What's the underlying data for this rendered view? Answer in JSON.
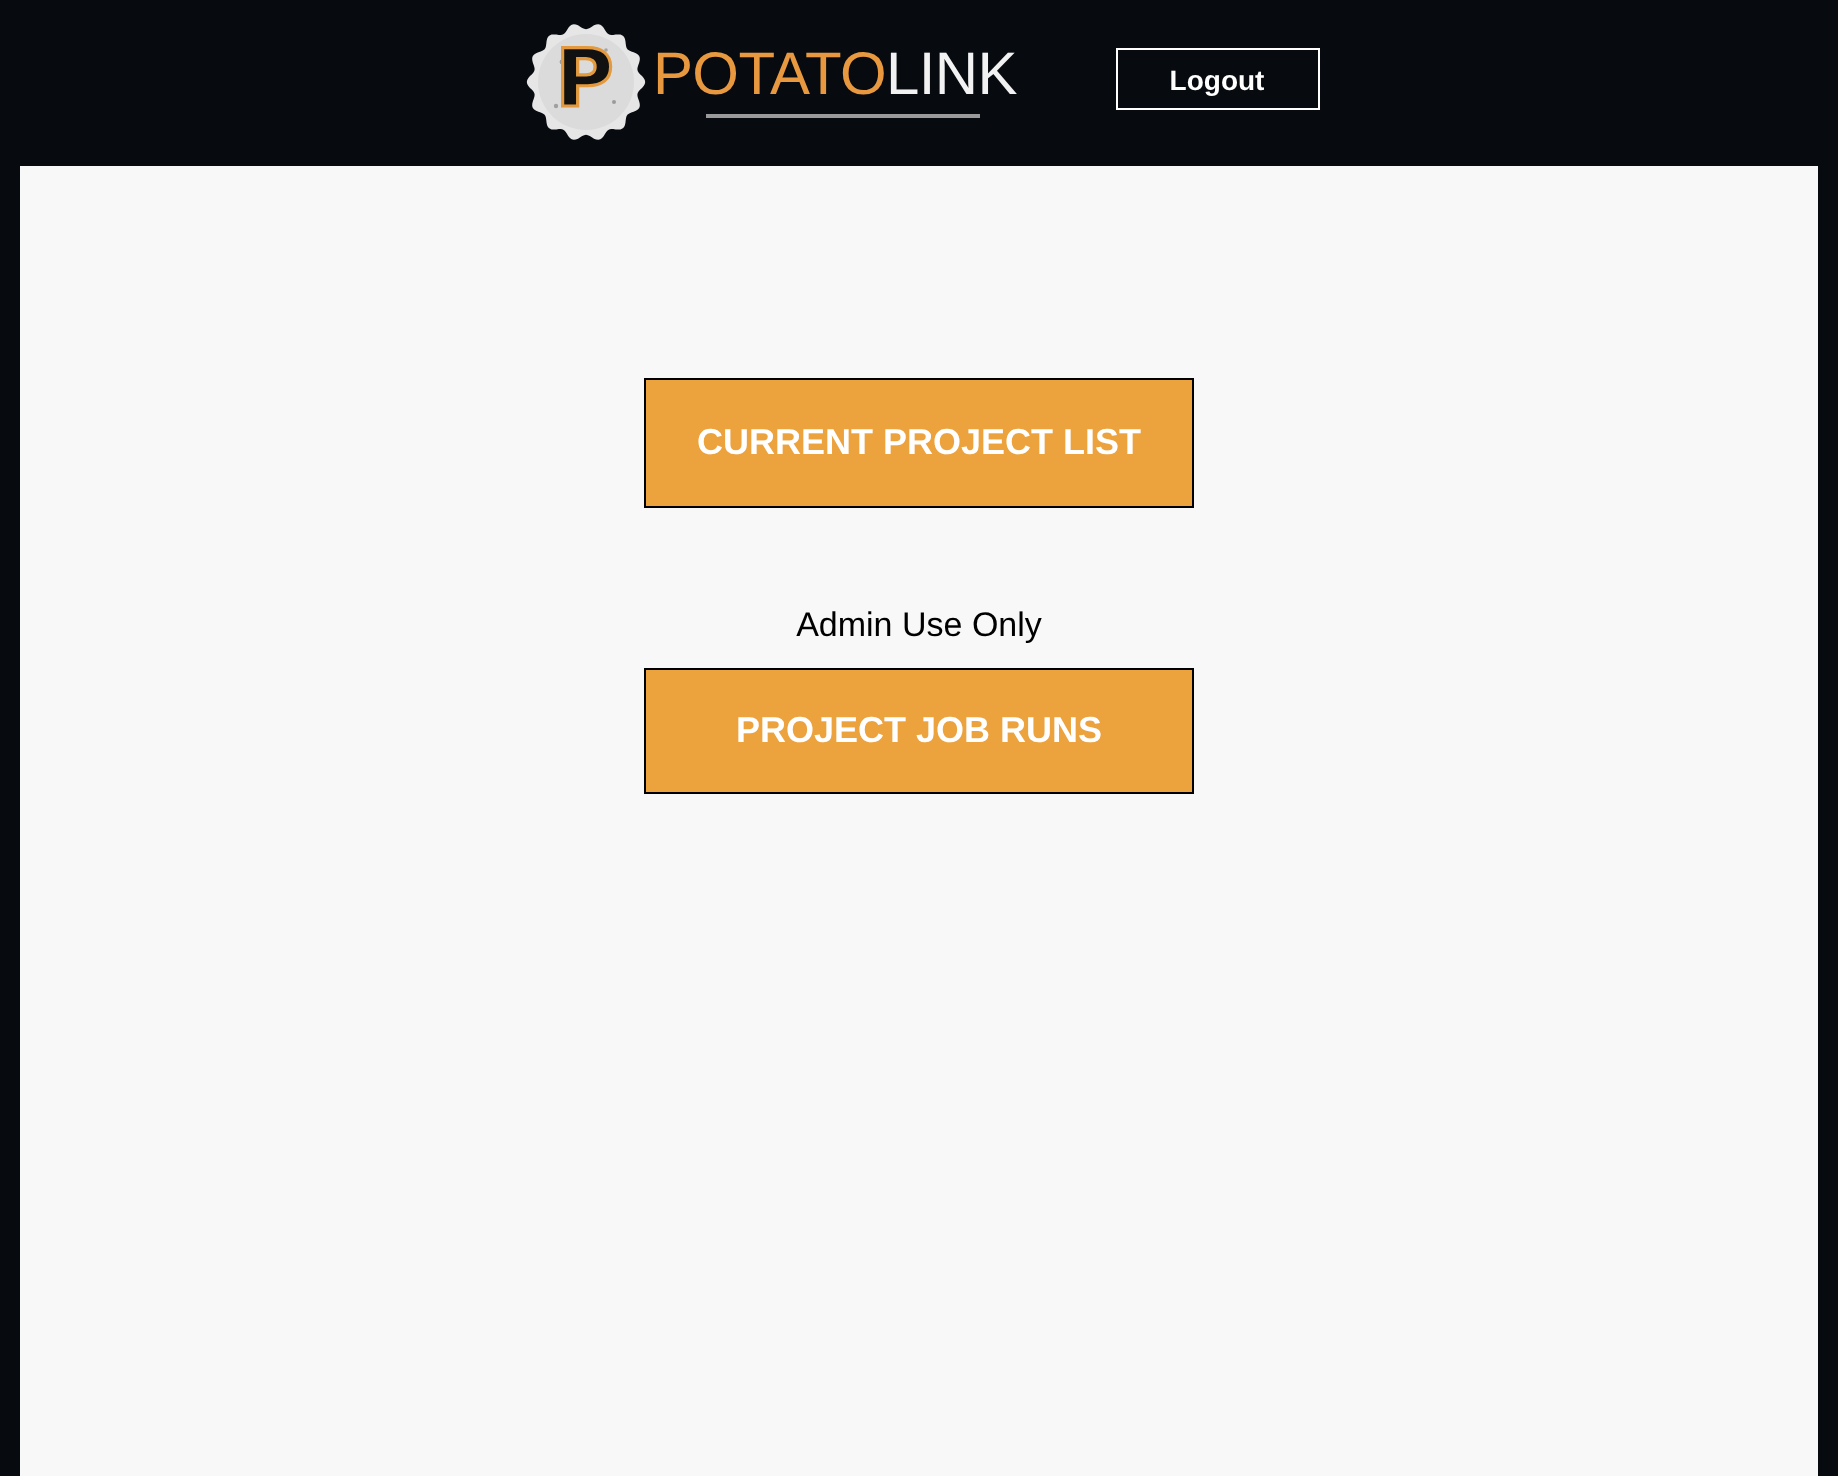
{
  "header": {
    "logo": {
      "badge_letter": "P",
      "wordmark_first": "POTATO",
      "wordmark_second": "LINK"
    },
    "logout_button": "Logout"
  },
  "main": {
    "items": [
      {
        "kind": "button",
        "label": "CURRENT PROJECT LIST"
      },
      {
        "kind": "note",
        "label": "Admin Use Only"
      },
      {
        "kind": "button",
        "label": "PROJECT JOB RUNS"
      }
    ]
  }
}
